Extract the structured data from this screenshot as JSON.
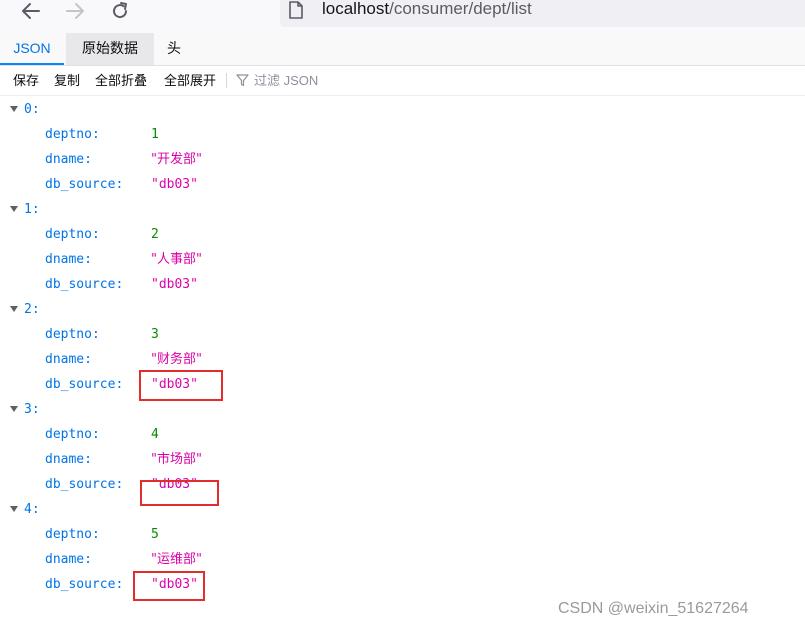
{
  "browser": {
    "back_icon": "arrow-left-icon",
    "forward_icon": "arrow-right-icon",
    "reload_icon": "reload-icon",
    "url_host": "localhost",
    "url_path": "/consumer/dept/list"
  },
  "tabs": [
    {
      "label": "JSON",
      "active": true
    },
    {
      "label": "原始数据",
      "active": false
    },
    {
      "label": "头",
      "active": false
    }
  ],
  "toolbar": {
    "save": "保存",
    "copy": "复制",
    "collapse_all": "全部折叠",
    "expand_all": "全部展开",
    "filter_placeholder": "过滤 JSON"
  },
  "records": [
    {
      "index": "0:",
      "deptno_key": "deptno:",
      "deptno": "1",
      "dname_key": "dname:",
      "dname": "\"开发部\"",
      "db_source_key": "db_source:",
      "db_source": "\"db03\""
    },
    {
      "index": "1:",
      "deptno_key": "deptno:",
      "deptno": "2",
      "dname_key": "dname:",
      "dname": "\"人事部\"",
      "db_source_key": "db_source:",
      "db_source": "\"db03\""
    },
    {
      "index": "2:",
      "deptno_key": "deptno:",
      "deptno": "3",
      "dname_key": "dname:",
      "dname": "\"财务部\"",
      "db_source_key": "db_source:",
      "db_source": "\"db03\""
    },
    {
      "index": "3:",
      "deptno_key": "deptno:",
      "deptno": "4",
      "dname_key": "dname:",
      "dname": "\"市场部\"",
      "db_source_key": "db_source:",
      "db_source": "\"db03\""
    },
    {
      "index": "4:",
      "deptno_key": "deptno:",
      "deptno": "5",
      "dname_key": "dname:",
      "dname": "\"运维部\"",
      "db_source_key": "db_source:",
      "db_source": "\"db03\""
    }
  ],
  "watermark": "CSDN @weixin_51627264",
  "colors": {
    "key": "#0074e8",
    "number": "#058b00",
    "string": "#dd00a9",
    "highlight": "#e32c2c"
  }
}
